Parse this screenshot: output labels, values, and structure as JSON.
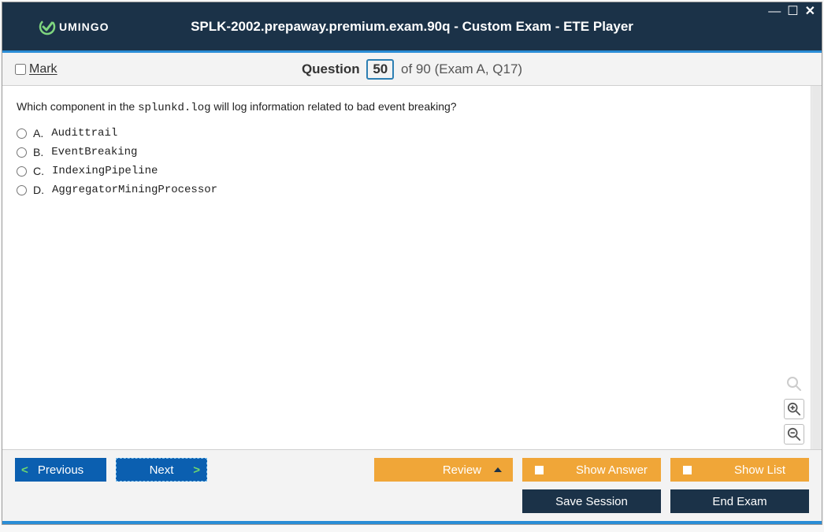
{
  "titlebar": {
    "logo_text": "UMINGO",
    "title": "SPLK-2002.prepaway.premium.exam.90q - Custom Exam - ETE Player"
  },
  "qheader": {
    "mark_label": "Mark",
    "question_word": "Question",
    "current": "50",
    "of_word": "of",
    "total": "90",
    "exam_ref": "(Exam A, Q17)"
  },
  "question": {
    "text_pre": "Which component in the ",
    "text_code": "splunkd.log",
    "text_post": " will log information related to bad event breaking?"
  },
  "options": [
    {
      "letter": "A.",
      "value": "Audittrail"
    },
    {
      "letter": "B.",
      "value": "EventBreaking"
    },
    {
      "letter": "C.",
      "value": "IndexingPipeline"
    },
    {
      "letter": "D.",
      "value": "AggregatorMiningProcessor"
    }
  ],
  "footer": {
    "previous": "Previous",
    "next": "Next",
    "review": "Review",
    "show_answer": "Show Answer",
    "show_list": "Show List",
    "save_session": "Save Session",
    "end_exam": "End Exam"
  }
}
